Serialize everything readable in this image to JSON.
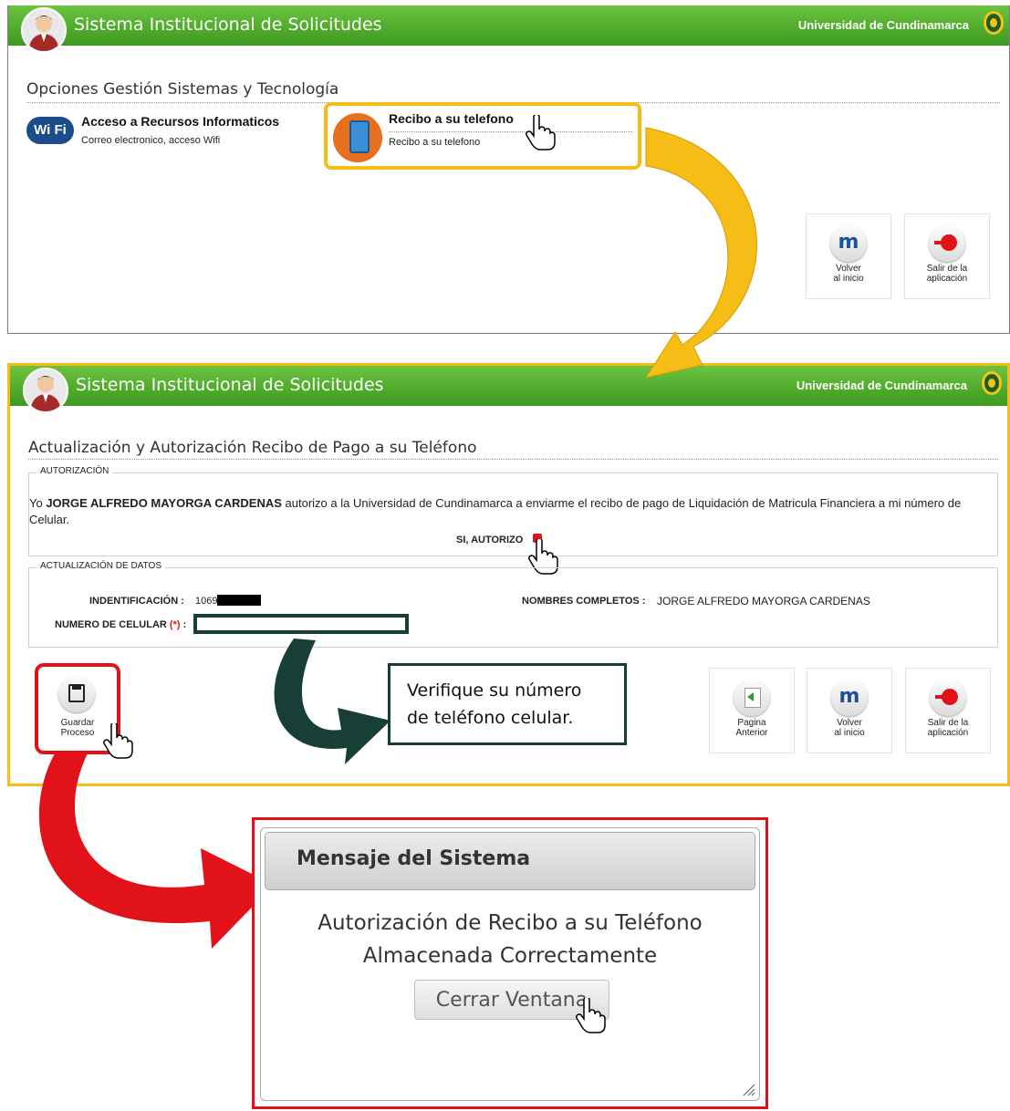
{
  "header": {
    "title": "Sistema Institucional de Solicitudes",
    "university": "Universidad de Cundinamarca"
  },
  "screen1": {
    "section_title": "Opciones Gestión Sistemas y Tecnología",
    "options": [
      {
        "title": "Acceso a Recursos Informaticos",
        "subtitle": "Correo electronico, acceso Wifi",
        "icon": "wifi-icon"
      },
      {
        "title": "Recibo a su telefono",
        "subtitle": "Recibo a su telefono",
        "icon": "phone-icon"
      }
    ],
    "tiles": [
      {
        "label": "Volver\nal inicio",
        "icon": "home-icon"
      },
      {
        "label": "Salir de la\naplicación",
        "icon": "exit-icon"
      }
    ]
  },
  "screen2": {
    "section_title": "Actualización y Autorización Recibo de Pago a su Teléfono",
    "authorization": {
      "legend": "AUTORIZACIÓN",
      "text_prefix": "Yo ",
      "name": "JORGE ALFREDO MAYORGA CARDENAS",
      "text_suffix": " autorizo a la Universidad de Cundinamarca a enviarme el recibo de pago de Liquidación de Matricula Financiera a mi número de Celular.",
      "checkbox_label": "SI, AUTORIZO"
    },
    "data_update": {
      "legend": "ACTUALIZACIÓN DE DATOS",
      "id_label": "INDENTIFICACIÓN :",
      "id_value": "1069",
      "names_label": "NOMBRES COMPLETOS :",
      "names_value": "JORGE ALFREDO MAYORGA CARDENAS",
      "phone_label": "NUMERO DE CELULAR",
      "required_mark": "(*)",
      "colon": ":",
      "phone_value": ""
    },
    "save_tile": {
      "label": "Guardar\nProceso",
      "icon": "save-icon"
    },
    "tiles": [
      {
        "label": "Pagina\nAnterior",
        "icon": "back-icon"
      },
      {
        "label": "Volver\nal inicio",
        "icon": "home-icon"
      },
      {
        "label": "Salir de la\naplicación",
        "icon": "exit-icon"
      }
    ]
  },
  "callout": {
    "line1": "Verifique su número",
    "line2": "de teléfono celular."
  },
  "dialog": {
    "title": "Mensaje del Sistema",
    "line1": "Autorización de Recibo a su Teléfono",
    "line2": "Almacenada Correctamente",
    "button": "Cerrar Ventana"
  },
  "colors": {
    "header_green": "#4fae2b",
    "yellow_highlight": "#f5bd15",
    "red_highlight": "#e2121b",
    "dark_green_callout": "#173f35"
  }
}
